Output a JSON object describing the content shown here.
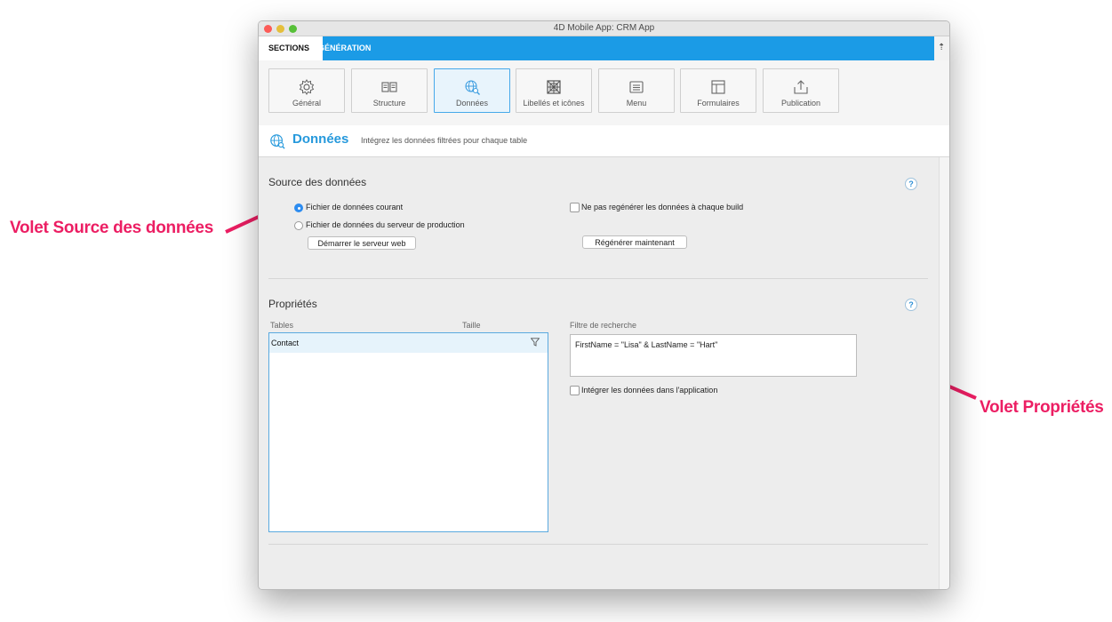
{
  "annotations": {
    "source_label": "Volet Source des données",
    "properties_label": "Volet Propriétés"
  },
  "window": {
    "title": "4D Mobile App: CRM App"
  },
  "tabs": [
    {
      "label": "SECTIONS"
    },
    {
      "label": "GÉNÉRATION"
    }
  ],
  "toolbar": {
    "items": [
      {
        "label": "Général",
        "icon": "gear-icon"
      },
      {
        "label": "Structure",
        "icon": "structure-icon"
      },
      {
        "label": "Données",
        "icon": "data-globe-icon"
      },
      {
        "label": "Libellés et icônes",
        "icon": "labels-icons-icon"
      },
      {
        "label": "Menu",
        "icon": "menu-icon"
      },
      {
        "label": "Formulaires",
        "icon": "forms-icon"
      },
      {
        "label": "Publication",
        "icon": "publish-icon"
      }
    ],
    "active": "Données"
  },
  "header": {
    "title": "Données",
    "description": "Intégrez les données filtrées pour chaque table"
  },
  "source": {
    "title": "Source des données",
    "help": "?",
    "radio_current": "Fichier de données courant",
    "radio_server": "Fichier de données du serveur de production",
    "start_server_button": "Démarrer le serveur web",
    "no_regen_label": "Ne pas regénérer les données à chaque build",
    "regen_button": "Régénérer maintenant"
  },
  "properties": {
    "title": "Propriétés",
    "help": "?",
    "col_tables": "Tables",
    "col_size": "Taille",
    "tables": [
      {
        "name": "Contact",
        "size": ""
      }
    ],
    "filter_label": "Filtre de recherche",
    "filter_value": "FirstName = \"Lisa\" & LastName = \"Hart\"",
    "embed_label": "Intégrer les données dans l'application"
  },
  "colors": {
    "accent": "#1b9be6",
    "annotation": "#ec1e63"
  }
}
